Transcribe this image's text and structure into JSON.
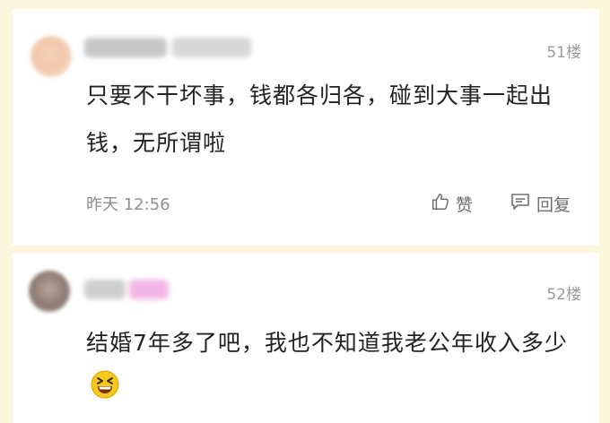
{
  "comments": [
    {
      "floor": "51楼",
      "text": "只要不干坏事，钱都各归各，碰到大事一起出钱，无所谓啦",
      "time": "昨天 12:56",
      "like_label": "赞",
      "reply_label": "回复"
    },
    {
      "floor": "52楼",
      "text": "结婚7年多了吧，我也不知道我老公年收入多少",
      "emoji": "laughing-emoji"
    }
  ],
  "icons": [
    "thumbs-up-icon",
    "comment-icon",
    "laughing-emoji"
  ]
}
